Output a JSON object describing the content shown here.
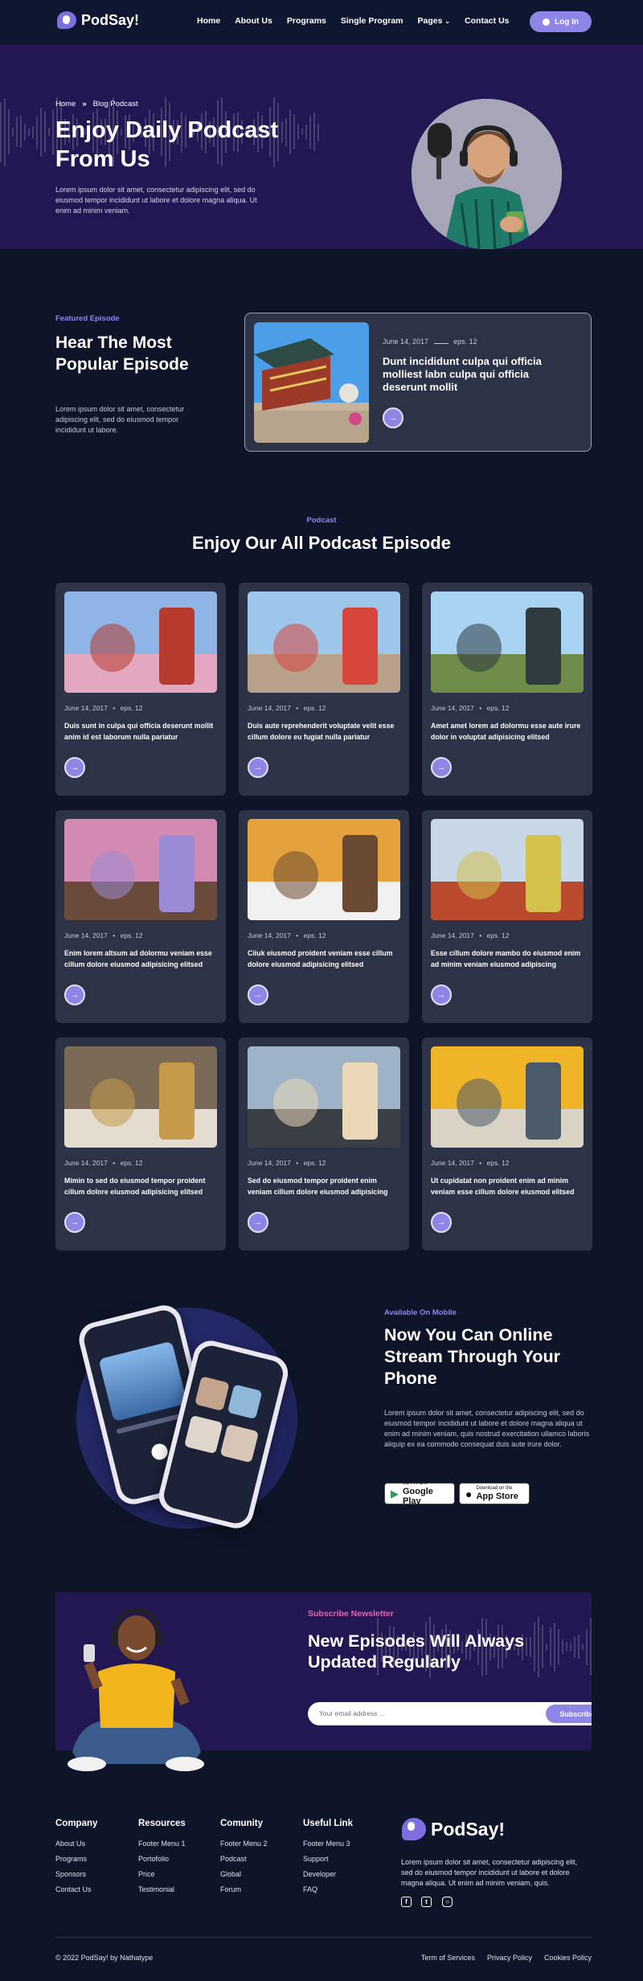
{
  "brand": {
    "name": "PodSay!"
  },
  "nav": {
    "links": [
      "Home",
      "About Us",
      "Programs",
      "Single Program",
      "Pages",
      "Contact Us"
    ],
    "login_label": "Log In"
  },
  "hero": {
    "breadcrumb_home": "Home",
    "breadcrumb_sep": "»",
    "breadcrumb_current": "Blog Podcast",
    "title": "Enjoy Daily Podcast From Us",
    "text": "Lorem ipsum dolor sit amet, consectetur adipiscing elit, sed do eiusmod tempor incididunt ut labore et dolore magna aliqua. Ut enim ad minim veniam."
  },
  "featured": {
    "eyebrow": "Featured Episode",
    "title": "Hear The Most Popular Episode",
    "text": "Lorem ipsum dolor sit amet, consectetur adipiscing elit, sed do eiusmod tempor incididunt ut labore.",
    "card": {
      "date": "June 14, 2017",
      "ep": "eps. 12",
      "title": "Dunt incididunt culpa qui officia molliest labn culpa qui officia deserunt mollit"
    }
  },
  "episodes": {
    "eyebrow": "Podcast",
    "title": "Enjoy Our All Podcast Episode",
    "items": [
      {
        "date": "June 14, 2017",
        "dot": "•",
        "ep": "eps. 12",
        "title": "Duis sunt in culpa qui officia deserunt mollit anim id est laborum nulla pariatur"
      },
      {
        "date": "June 14, 2017",
        "dot": "•",
        "ep": "eps. 12",
        "title": "Duis aute reprehenderit voluptate velit esse cillum dolore eu fugiat nulla pariatur"
      },
      {
        "date": "June 14, 2017",
        "dot": "•",
        "ep": "eps. 12",
        "title": "Amet amet lorem ad dolormu esse aute irure dolor in voluptat adipisicing elitsed"
      },
      {
        "date": "June 14, 2017",
        "dot": "•",
        "ep": "eps. 12",
        "title": "Enim lorem altsum ad dolormu veniam esse cillum dolore eiusmod adipisicing elitsed"
      },
      {
        "date": "June 14, 2017",
        "dot": "•",
        "ep": "eps. 12",
        "title": "Ciiuk eiusmod proident veniam esse cillum dolore eiusmod adipisicing elitsed"
      },
      {
        "date": "June 14, 2017",
        "dot": "•",
        "ep": "eps. 12",
        "title": "Esse cillum dolore mambo do eiusmod enim ad minim veniam eiusmod adipiscing"
      },
      {
        "date": "June 14, 2017",
        "dot": "•",
        "ep": "eps. 12",
        "title": "Mimin to sed do eiusmod tempor proident cillum dolore eiusmod adipisicing elitsed"
      },
      {
        "date": "June 14, 2017",
        "dot": "•",
        "ep": "eps. 12",
        "title": "Sed do eiusmod tempor proident enim veniam cillum dolore eiusmod adipisicing"
      },
      {
        "date": "June 14, 2017",
        "dot": "•",
        "ep": "eps. 12",
        "title": "Ut cupidatat non proident enim ad minim veniam esse cillum dolore eiusmod elitsed"
      }
    ]
  },
  "mobile": {
    "eyebrow": "Available On Mobile",
    "title": "Now You Can Online Stream Through Your Phone",
    "text": "Lorem ipsum dolor sit amet, consectetur adipiscing elit, sed do eiusmod tempor incididunt ut labore et dolore magna aliqua ut enim ad minim veniam, quis nostrud exercitation ullamco laboris aliquip ex ea commodo consequat duis aute irure dolor.",
    "google_small": "GET IT ON",
    "google_big": "Google Play",
    "apple_small": "Download on the",
    "apple_big": "App Store"
  },
  "newsletter": {
    "eyebrow": "Subscribe Newsletter",
    "title": "New Episodes Will Always Updated Regularly",
    "placeholder": "Your email address ...",
    "button": "Subscribe"
  },
  "footer": {
    "columns": [
      {
        "title": "Company",
        "links": [
          "About Us",
          "Programs",
          "Sponsors",
          "Contact Us"
        ]
      },
      {
        "title": "Resources",
        "links": [
          "Footer Menu 1",
          "Portofolio",
          "Price",
          "Testimonial"
        ]
      },
      {
        "title": "Comunity",
        "links": [
          "Footer Menu 2",
          "Podcast",
          "Global",
          "Forum"
        ]
      },
      {
        "title": "Useful Link",
        "links": [
          "Footer Menu 3",
          "Support",
          "Developer",
          "FAQ"
        ]
      }
    ],
    "description": "Lorem ipsum dolor sit amet, consectetur adipiscing elit, sed do eiusmod tempor incididunt ut labore et dolore magna aliqua. Ut enim ad minim veniam, quis.",
    "copyright": "© 2022 PodSay! by Nathatype",
    "legal": [
      "Term of Services",
      "Privacy Policy",
      "Cookies Policy"
    ]
  },
  "colors": {
    "accent": "#8e86e6",
    "hero_bg": "#221752",
    "page_bg": "#0e1529",
    "card_bg": "#2c3346",
    "pink": "#e365b4"
  }
}
